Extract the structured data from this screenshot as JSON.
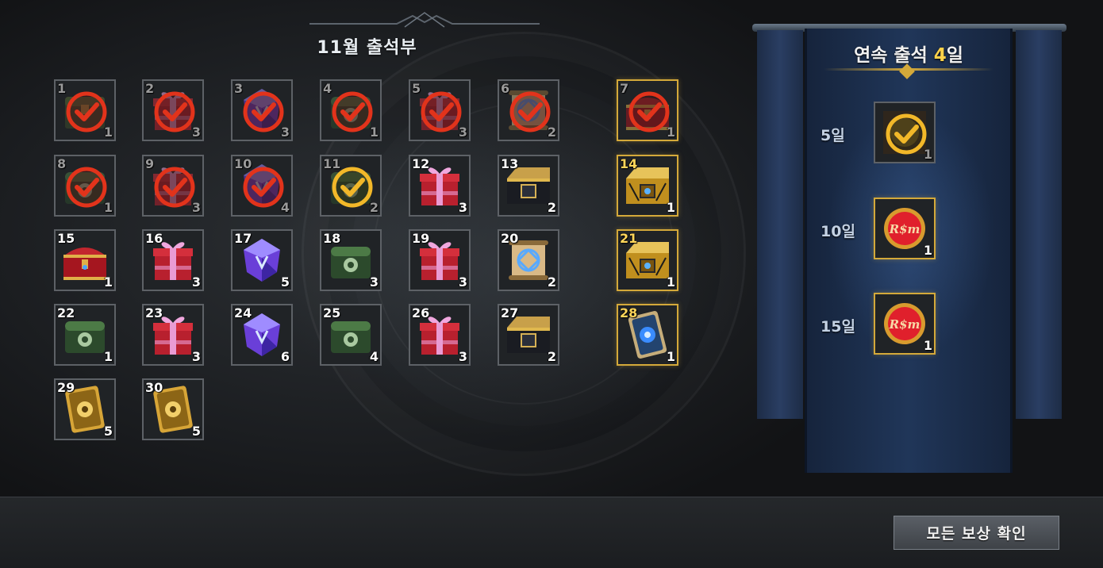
{
  "title": "11월 출석부",
  "days": [
    {
      "day": "1",
      "qty": "1",
      "item": "chest-icon",
      "checked": true,
      "special": false
    },
    {
      "day": "2",
      "qty": "3",
      "item": "gift-box-icon",
      "checked": true,
      "special": false
    },
    {
      "day": "3",
      "qty": "3",
      "item": "crystal-icon",
      "checked": true,
      "special": false
    },
    {
      "day": "4",
      "qty": "1",
      "item": "jade-chest-icon",
      "checked": true,
      "special": false
    },
    {
      "day": "5",
      "qty": "3",
      "item": "gift-box-icon",
      "checked": true,
      "special": false
    },
    {
      "day": "6",
      "qty": "2",
      "item": "scroll-icon",
      "checked": true,
      "special": false
    },
    {
      "day": "7",
      "qty": "1",
      "item": "treasure-chest-icon",
      "checked": true,
      "special": true
    },
    {
      "day": "8",
      "qty": "1",
      "item": "jade-chest-icon",
      "checked": true,
      "special": false
    },
    {
      "day": "9",
      "qty": "3",
      "item": "gift-box-icon",
      "checked": true,
      "special": false
    },
    {
      "day": "10",
      "qty": "4",
      "item": "crystal-icon",
      "checked": true,
      "special": false
    },
    {
      "day": "11",
      "qty": "2",
      "item": "jade-chest-icon",
      "checked": true,
      "today": true,
      "special": false
    },
    {
      "day": "12",
      "qty": "3",
      "item": "gift-box-icon",
      "checked": false,
      "special": false
    },
    {
      "day": "13",
      "qty": "2",
      "item": "black-box-icon",
      "checked": false,
      "special": false
    },
    {
      "day": "14",
      "qty": "1",
      "item": "gold-box-icon",
      "checked": false,
      "special": true
    },
    {
      "day": "15",
      "qty": "1",
      "item": "treasure-chest-icon",
      "checked": false,
      "special": false
    },
    {
      "day": "16",
      "qty": "3",
      "item": "gift-box-icon",
      "checked": false,
      "special": false
    },
    {
      "day": "17",
      "qty": "5",
      "item": "crystal-icon",
      "checked": false,
      "special": false
    },
    {
      "day": "18",
      "qty": "3",
      "item": "jade-chest-icon",
      "checked": false,
      "special": false
    },
    {
      "day": "19",
      "qty": "3",
      "item": "gift-box-icon",
      "checked": false,
      "special": false
    },
    {
      "day": "20",
      "qty": "2",
      "item": "scroll-icon",
      "checked": false,
      "special": false
    },
    {
      "day": "21",
      "qty": "1",
      "item": "gold-box-icon",
      "checked": false,
      "special": true
    },
    {
      "day": "22",
      "qty": "1",
      "item": "jade-chest-icon",
      "checked": false,
      "special": false
    },
    {
      "day": "23",
      "qty": "3",
      "item": "gift-box-icon",
      "checked": false,
      "special": false
    },
    {
      "day": "24",
      "qty": "6",
      "item": "crystal-icon",
      "checked": false,
      "special": false
    },
    {
      "day": "25",
      "qty": "4",
      "item": "jade-chest-icon",
      "checked": false,
      "special": false
    },
    {
      "day": "26",
      "qty": "3",
      "item": "gift-box-icon",
      "checked": false,
      "special": false
    },
    {
      "day": "27",
      "qty": "2",
      "item": "black-box-icon",
      "checked": false,
      "special": false
    },
    {
      "day": "28",
      "qty": "1",
      "item": "blue-card-icon",
      "checked": false,
      "special": true
    },
    {
      "day": "29",
      "qty": "5",
      "item": "gold-card-icon",
      "checked": false,
      "special": false
    },
    {
      "day": "30",
      "qty": "5",
      "item": "gold-card-icon",
      "checked": false,
      "special": false
    }
  ],
  "streak": {
    "title_prefix": "연속 출석 ",
    "title_num": "4",
    "title_suffix": "일",
    "rewards": [
      {
        "label": "5일",
        "qty": "1",
        "item": "streak-check-icon",
        "claimed": true
      },
      {
        "label": "10일",
        "qty": "1",
        "item": "ruby-coin-icon",
        "claimed": false
      },
      {
        "label": "15일",
        "qty": "1",
        "item": "ruby-coin-icon",
        "claimed": false
      }
    ]
  },
  "confirm_button": "모든 보상 확인",
  "colors": {
    "gold": "#d4a93a",
    "check_red": "#e2331b",
    "check_gold": "#f2b829",
    "banner_blue": "#203659"
  }
}
